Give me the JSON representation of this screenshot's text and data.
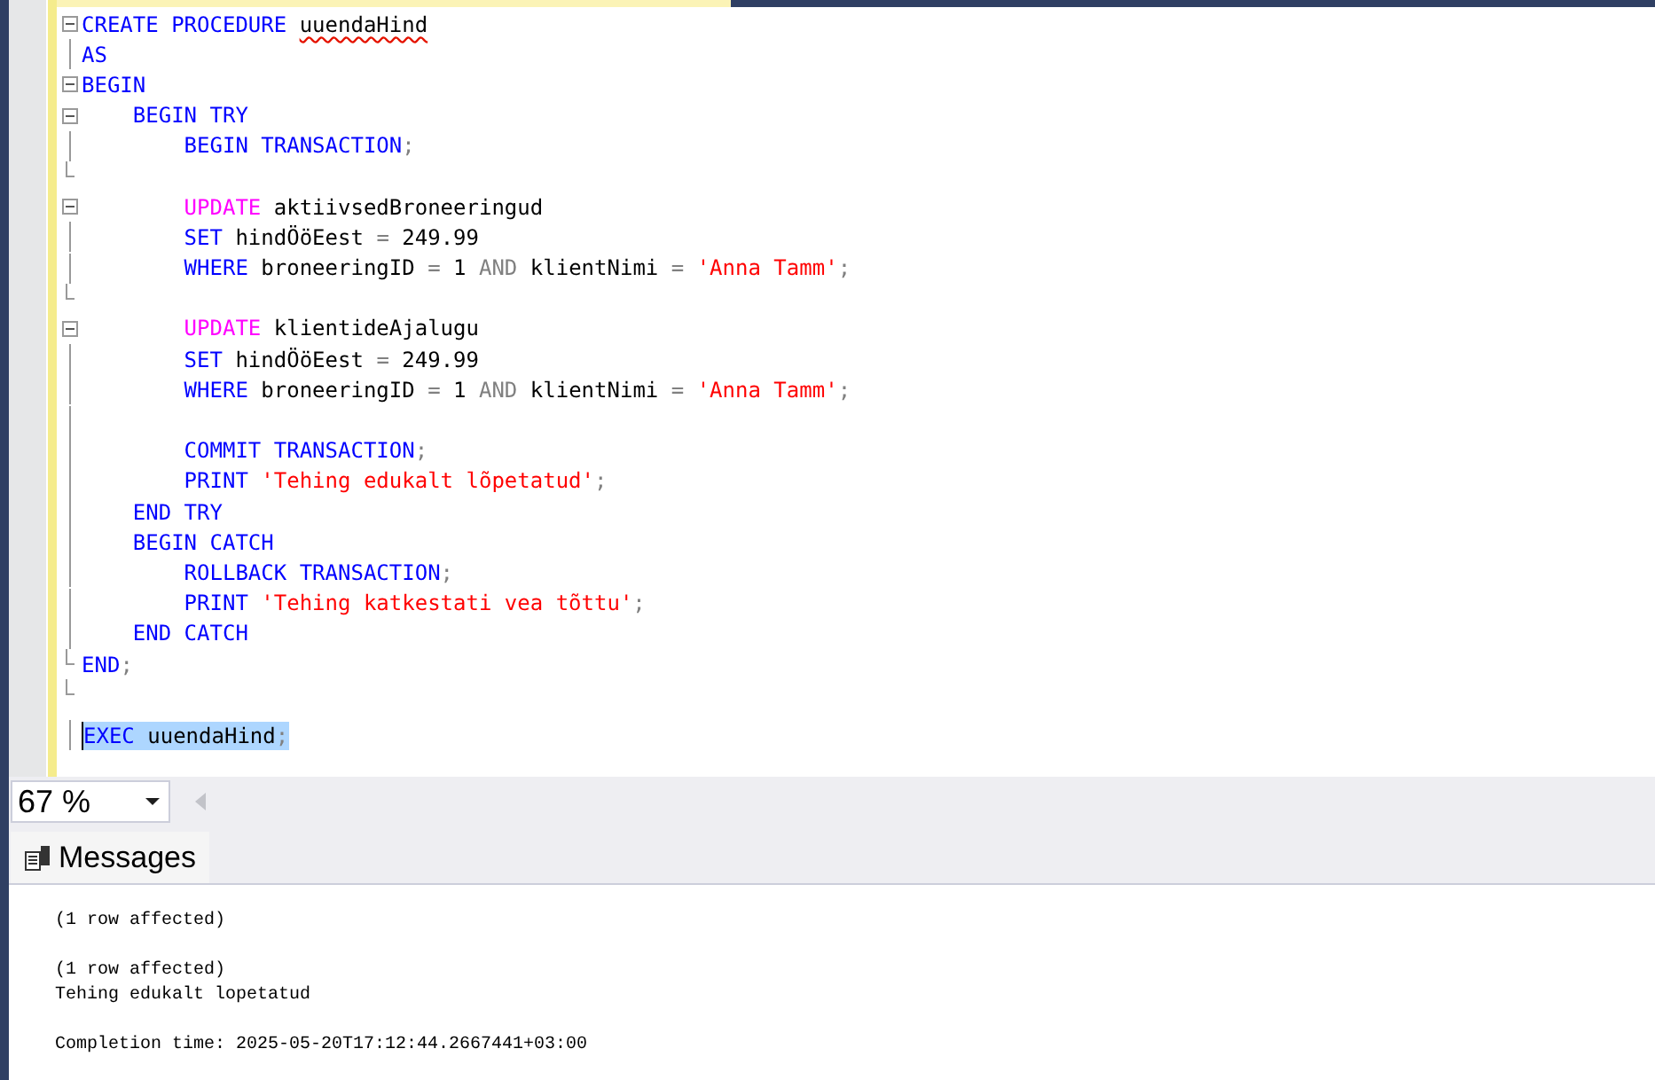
{
  "editor": {
    "lines": [
      {
        "kind": "fold_start",
        "selected": false,
        "tokens": [
          {
            "kind": "keyword",
            "text": "CREATE PROCEDURE "
          },
          {
            "kind": "ident",
            "text": "uuendaHind",
            "error": true
          }
        ]
      },
      {
        "kind": "plain",
        "selected": false,
        "tokens": [
          {
            "kind": "keyword",
            "text": "AS"
          }
        ]
      },
      {
        "kind": "fold_start",
        "selected": false,
        "tokens": [
          {
            "kind": "keyword",
            "text": "BEGIN"
          }
        ]
      },
      {
        "kind": "fold_start",
        "selected": false,
        "tokens": [
          {
            "kind": "keyword",
            "text": "    BEGIN TRY"
          }
        ]
      },
      {
        "kind": "plain",
        "selected": false,
        "tokens": [
          {
            "kind": "keyword",
            "text": "        BEGIN TRANSACTION"
          },
          {
            "kind": "operator",
            "text": ";"
          }
        ]
      },
      {
        "kind": "fold_end",
        "selected": false
      },
      {
        "kind": "fold_start",
        "selected": false,
        "tokens": [
          {
            "kind": "function",
            "text": "        UPDATE "
          },
          {
            "kind": "ident",
            "text": "aktiivsedBroneeringud"
          }
        ]
      },
      {
        "kind": "plain",
        "selected": false,
        "tokens": [
          {
            "kind": "keyword",
            "text": "        SET "
          },
          {
            "kind": "ident",
            "text": "hindÖöEest "
          },
          {
            "kind": "operator",
            "text": "= "
          },
          {
            "kind": "ident",
            "text": "249.99"
          }
        ]
      },
      {
        "kind": "plain",
        "selected": false,
        "tokens": [
          {
            "kind": "keyword",
            "text": "        WHERE "
          },
          {
            "kind": "ident",
            "text": "broneeringID "
          },
          {
            "kind": "operator",
            "text": "= "
          },
          {
            "kind": "ident",
            "text": "1 "
          },
          {
            "kind": "operator",
            "text": "AND "
          },
          {
            "kind": "ident",
            "text": "klientNimi "
          },
          {
            "kind": "operator",
            "text": "= "
          },
          {
            "kind": "string",
            "text": "'Anna Tamm'"
          },
          {
            "kind": "operator",
            "text": ";"
          }
        ]
      },
      {
        "kind": "fold_end",
        "selected": false
      },
      {
        "kind": "fold_start",
        "selected": false,
        "tokens": [
          {
            "kind": "function",
            "text": "        UPDATE "
          },
          {
            "kind": "ident",
            "text": "klientideAjalugu"
          }
        ]
      },
      {
        "kind": "plain",
        "selected": false,
        "tokens": [
          {
            "kind": "keyword",
            "text": "        SET "
          },
          {
            "kind": "ident",
            "text": "hindÖöEest "
          },
          {
            "kind": "operator",
            "text": "= "
          },
          {
            "kind": "ident",
            "text": "249.99"
          }
        ]
      },
      {
        "kind": "plain",
        "selected": false,
        "tokens": [
          {
            "kind": "keyword",
            "text": "        WHERE "
          },
          {
            "kind": "ident",
            "text": "broneeringID "
          },
          {
            "kind": "operator",
            "text": "= "
          },
          {
            "kind": "ident",
            "text": "1 "
          },
          {
            "kind": "operator",
            "text": "AND "
          },
          {
            "kind": "ident",
            "text": "klientNimi "
          },
          {
            "kind": "operator",
            "text": "= "
          },
          {
            "kind": "string",
            "text": "'Anna Tamm'"
          },
          {
            "kind": "operator",
            "text": ";"
          }
        ]
      },
      {
        "kind": "plain",
        "selected": false
      },
      {
        "kind": "plain",
        "selected": false,
        "tokens": [
          {
            "kind": "keyword",
            "text": "        COMMIT TRANSACTION"
          },
          {
            "kind": "operator",
            "text": ";"
          }
        ]
      },
      {
        "kind": "plain",
        "selected": false,
        "tokens": [
          {
            "kind": "keyword",
            "text": "        PRINT "
          },
          {
            "kind": "string",
            "text": "'Tehing edukalt lõpetatud'"
          },
          {
            "kind": "operator",
            "text": ";"
          }
        ]
      },
      {
        "kind": "plain",
        "selected": false,
        "tokens": [
          {
            "kind": "keyword",
            "text": "    END TRY"
          }
        ]
      },
      {
        "kind": "plain",
        "selected": false,
        "tokens": [
          {
            "kind": "keyword",
            "text": "    BEGIN CATCH"
          }
        ]
      },
      {
        "kind": "plain",
        "selected": false,
        "tokens": [
          {
            "kind": "keyword",
            "text": "        ROLLBACK TRANSACTION"
          },
          {
            "kind": "operator",
            "text": ";"
          }
        ]
      },
      {
        "kind": "plain",
        "selected": false,
        "tokens": [
          {
            "kind": "keyword",
            "text": "        PRINT "
          },
          {
            "kind": "string",
            "text": "'Tehing katkestati vea tõttu'"
          },
          {
            "kind": "operator",
            "text": ";"
          }
        ]
      },
      {
        "kind": "plain",
        "selected": false,
        "tokens": [
          {
            "kind": "keyword",
            "text": "    END CATCH"
          }
        ]
      },
      {
        "kind": "fold_end",
        "selected": false,
        "tokens": [
          {
            "kind": "keyword",
            "text": "END"
          },
          {
            "kind": "operator",
            "text": ";"
          }
        ]
      },
      {
        "kind": "fold_end",
        "selected": false
      },
      {
        "kind": "plain",
        "selected": true,
        "tokens": [
          {
            "kind": "keyword",
            "text": "EXEC "
          },
          {
            "kind": "ident",
            "text": "uuendaHind"
          },
          {
            "kind": "operator",
            "text": ";"
          }
        ]
      }
    ]
  },
  "zoom": {
    "value": "67 %"
  },
  "results": {
    "tabs": [
      {
        "label": "Messages",
        "selected": true
      }
    ],
    "message_blocks": [
      {
        "lines": [
          "(1 row affected)"
        ]
      },
      {
        "lines": [
          "(1 row affected)",
          "Tehing edukalt lopetatud"
        ]
      },
      {
        "lines": [
          "Completion time: 2025-05-20T17:12:44.2667441+03:00"
        ]
      }
    ]
  }
}
